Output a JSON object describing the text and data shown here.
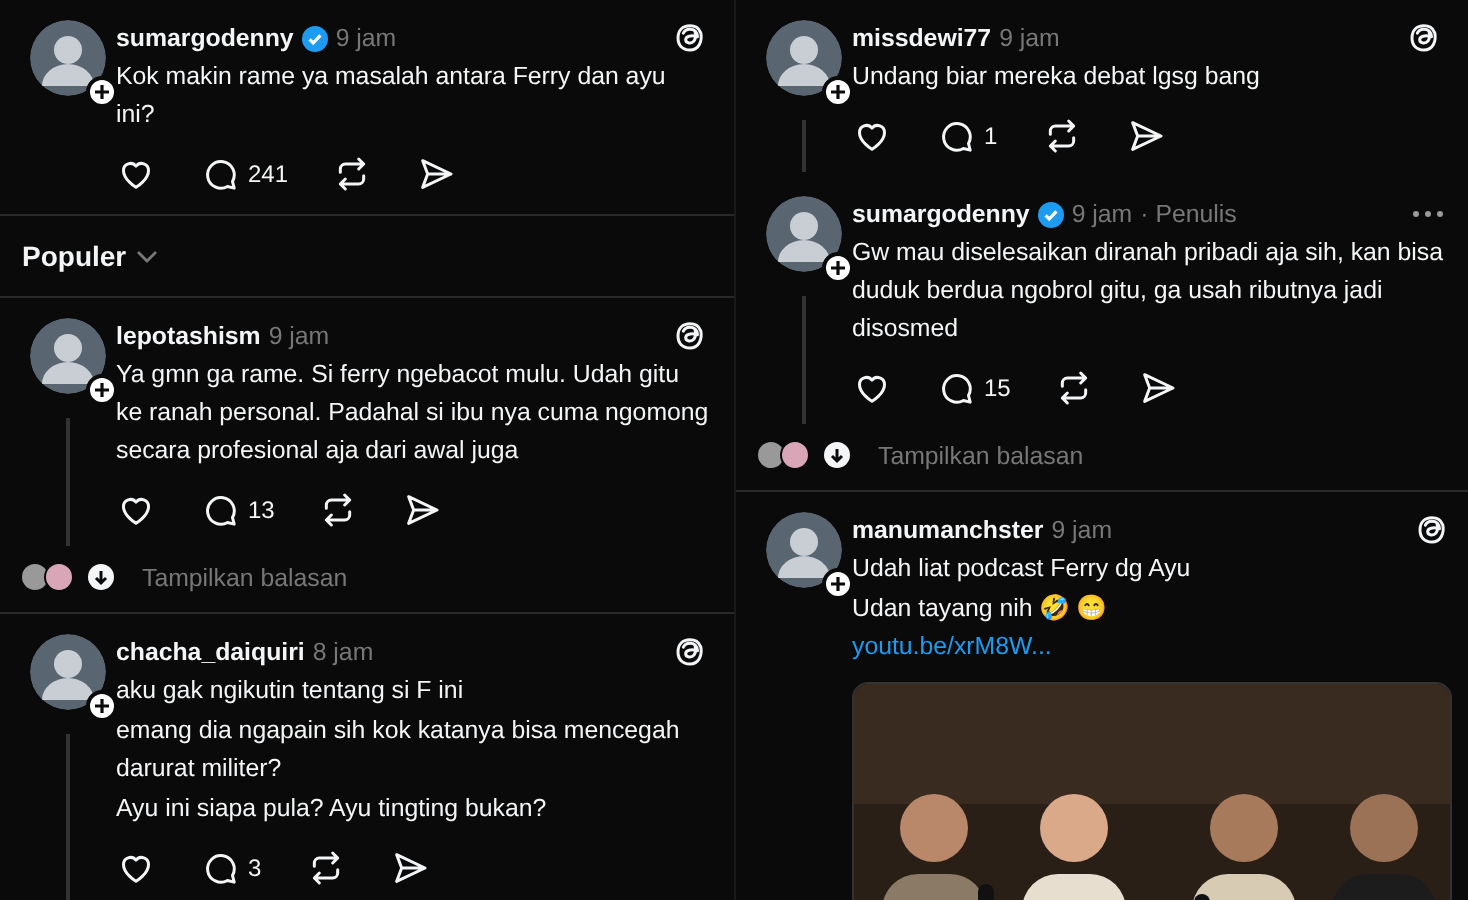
{
  "panels": [
    {
      "blocks": [
        {
          "kind": "thread",
          "posts": [
            {
              "username": "sumargodenny",
              "verified": true,
              "time": "9 jam",
              "more_menu": false,
              "thread_line": false,
              "lines": [
                "Kok makin rame ya masalah antara Ferry dan ayu ini?"
              ],
              "replies": "241"
            }
          ]
        },
        {
          "kind": "sort",
          "label": "Populer"
        },
        {
          "kind": "thread",
          "posts": [
            {
              "username": "lepotashism",
              "verified": false,
              "time": "9 jam",
              "more_menu": false,
              "thread_line": true,
              "lines": [
                "Ya gmn ga rame. Si ferry ngebacot mulu. Udah gitu ke ranah personal. Padahal si ibu nya cuma ngomong secara profesional aja dari awal juga"
              ],
              "replies": "13"
            }
          ],
          "show_replies": "Tampilkan balasan"
        },
        {
          "kind": "thread",
          "posts": [
            {
              "username": "chacha_daiquiri",
              "verified": false,
              "time": "8 jam",
              "more_menu": false,
              "thread_line": true,
              "lines": [
                "aku gak ngikutin tentang si F ini",
                "emang dia ngapain sih kok katanya bisa mencegah darurat militer?",
                "Ayu ini siapa pula? Ayu tingting bukan?"
              ],
              "replies": "3"
            }
          ]
        }
      ]
    },
    {
      "blocks": [
        {
          "kind": "thread",
          "posts": [
            {
              "username": "missdewi77",
              "verified": false,
              "time": "9 jam",
              "more_menu": false,
              "thread_line": true,
              "lines": [
                "Undang biar mereka debat lgsg bang"
              ],
              "replies": "1"
            },
            {
              "username": "sumargodenny",
              "verified": true,
              "time": "9 jam",
              "role": "· Penulis",
              "more_menu": true,
              "thread_line": true,
              "lines": [
                "Gw mau diselesaikan diranah pribadi aja sih, kan bisa duduk berdua ngobrol gitu, ga usah ributnya jadi disosmed"
              ],
              "replies": "15"
            }
          ],
          "show_replies": "Tampilkan balasan"
        },
        {
          "kind": "thread",
          "posts": [
            {
              "username": "manumanchster",
              "verified": false,
              "time": "9 jam",
              "more_menu": false,
              "thread_line": false,
              "lines": [
                "Udah liat podcast Ferry dg Ayu",
                "Udan tayang nih 🤣 😁"
              ],
              "link": "youtu.be/xrM8W...",
              "media": {
                "kind": "picture"
              }
            }
          ]
        }
      ]
    }
  ]
}
